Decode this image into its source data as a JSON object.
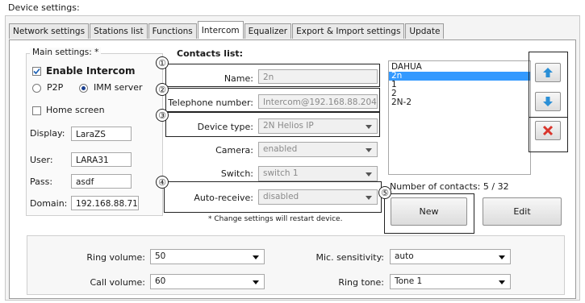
{
  "window_title": "Device settings:",
  "tabs": [
    "Network settings",
    "Stations list",
    "Functions",
    "Intercom",
    "Equalizer",
    "Export & Import settings",
    "Update"
  ],
  "main_settings": {
    "title": "Main settings: *",
    "enable_intercom": "Enable Intercom",
    "p2p": "P2P",
    "imm_server": "IMM server",
    "home_screen": "Home screen",
    "display_label": "Display:",
    "display_value": "LaraZS",
    "user_label": "User:",
    "user_value": "LARA31",
    "pass_label": "Pass:",
    "pass_value": "asdf",
    "domain_label": "Domain:",
    "domain_value": "192.168.88.71"
  },
  "contacts": {
    "title": "Contacts list:",
    "name_label": "Name:",
    "name_value": "2n",
    "phone_label": "Telephone number:",
    "phone_value": "Intercom@192.168.88.204",
    "device_type_label": "Device type:",
    "device_type_value": "2N Helios IP",
    "camera_label": "Camera:",
    "camera_value": "enabled",
    "switch_label": "Switch:",
    "switch_value": "switch 1",
    "auto_receive_label": "Auto-receive:",
    "auto_receive_value": "disabled",
    "restart_note": "* Change settings will restart device.",
    "list_items": [
      "DAHUA",
      "2n",
      "1",
      "2",
      "2N-2"
    ],
    "selected_index": 1,
    "count_text": "Number of contacts: 5 / 32",
    "new_button": "New",
    "edit_button": "Edit"
  },
  "callouts": [
    "①",
    "②",
    "③",
    "④",
    "⑤"
  ],
  "audio": {
    "ring_volume_label": "Ring volume:",
    "ring_volume_value": "50",
    "call_volume_label": "Call volume:",
    "call_volume_value": "60",
    "mic_label": "Mic. sensitivity:",
    "mic_value": "auto",
    "ring_tone_label": "Ring tone:",
    "ring_tone_value": "Tone 1"
  },
  "colors": {
    "selection": "#3399ff",
    "arrow_blue": "#2a8fd6",
    "delete_red": "#d9342b"
  },
  "icons": {
    "up": "arrow-up-icon",
    "down": "arrow-down-icon",
    "delete": "delete-x-icon"
  }
}
